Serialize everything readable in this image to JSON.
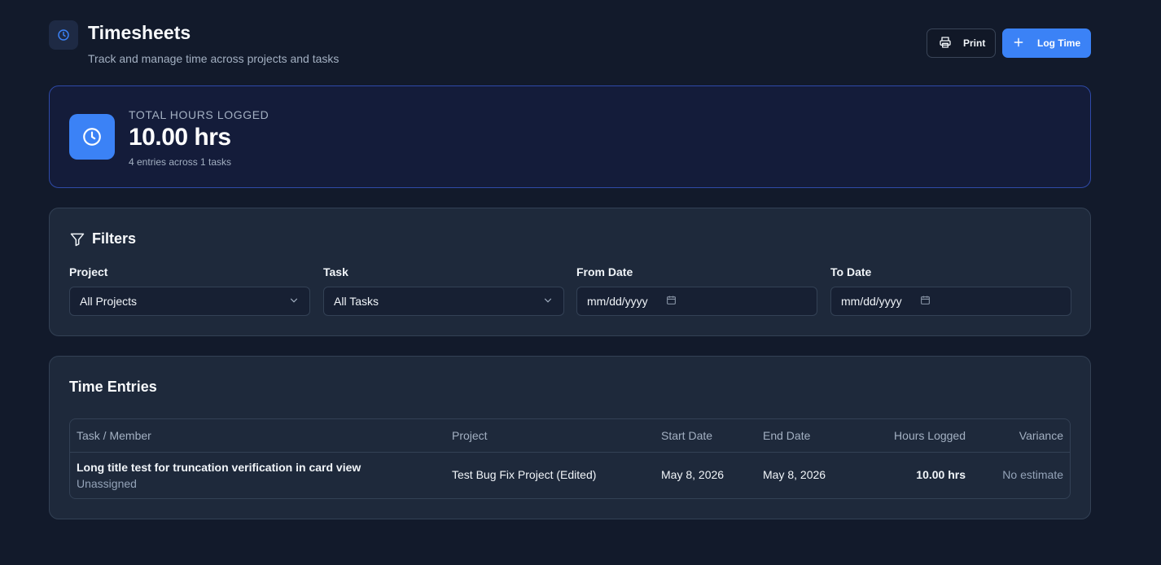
{
  "header": {
    "title": "Timesheets",
    "subtitle": "Track and manage time across projects and tasks",
    "print_label": "Print",
    "log_time_label": "Log Time"
  },
  "stats": {
    "label": "TOTAL HOURS LOGGED",
    "value": "10.00 hrs",
    "sub": "4 entries across 1 tasks"
  },
  "filters": {
    "title": "Filters",
    "project": {
      "label": "Project",
      "value": "All Projects"
    },
    "task": {
      "label": "Task",
      "value": "All Tasks"
    },
    "from_date": {
      "label": "From Date",
      "placeholder": "mm/dd/yyyy"
    },
    "to_date": {
      "label": "To Date",
      "placeholder": "mm/dd/yyyy"
    }
  },
  "entries": {
    "title": "Time Entries",
    "columns": {
      "task_member": "Task / Member",
      "project": "Project",
      "start_date": "Start Date",
      "end_date": "End Date",
      "hours": "Hours Logged",
      "variance": "Variance"
    },
    "rows": [
      {
        "task": "Long title test for truncation verification in card view",
        "member": "Unassigned",
        "project": "Test Bug Fix Project (Edited)",
        "start_date": "May 8, 2026",
        "end_date": "May 8, 2026",
        "hours": "10.00 hrs",
        "variance": "No estimate"
      }
    ]
  },
  "colors": {
    "accent": "#3b82f6",
    "background": "#121a2b",
    "card": "#1e293b",
    "border": "#334155"
  }
}
